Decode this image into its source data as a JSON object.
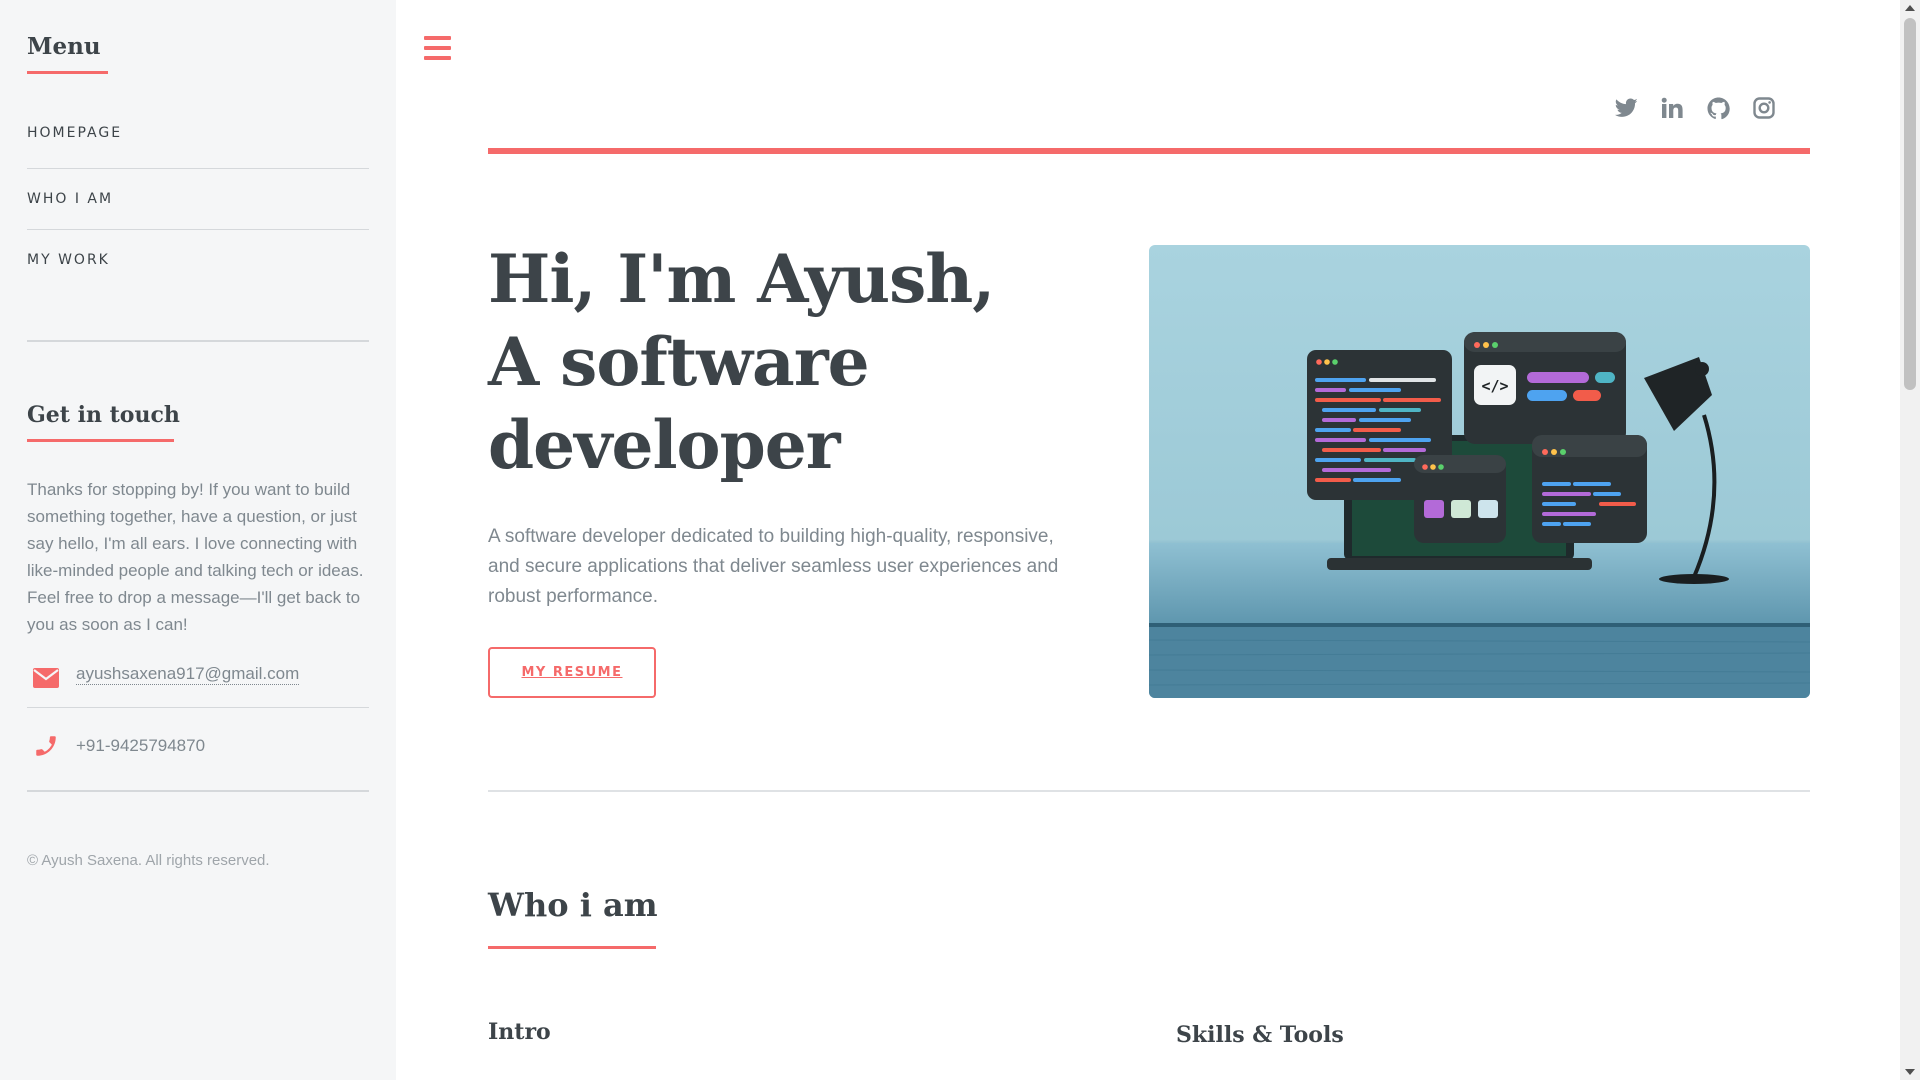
{
  "sidebar": {
    "menu_title": "Menu",
    "menu_items": [
      {
        "label": "HOMEPAGE"
      },
      {
        "label": "WHO I AM"
      },
      {
        "label": "MY WORK"
      }
    ],
    "touch_title": "Get in touch",
    "touch_text": "Thanks for stopping by! If you want to build something together, have a question, or just say hello, I'm all ears. I love connecting with like-minded people and talking tech or ideas. Feel free to drop a message—I'll get back to you as soon as I can!",
    "email": "ayushsaxena917@gmail.com",
    "phone": "+91-9425794870",
    "copyright": "© Ayush Saxena. All rights reserved."
  },
  "header": {
    "socials": [
      {
        "icon": "twitter-icon"
      },
      {
        "icon": "linkedin-icon"
      },
      {
        "icon": "github-icon"
      },
      {
        "icon": "instagram-icon"
      }
    ]
  },
  "hero": {
    "title_line1": "Hi, I'm Ayush,",
    "title_line2": "A software",
    "title_line3": "developer",
    "description": "A software developer dedicated to building high-quality, responsive, and secure applications that deliver seamless user experiences and robust performance.",
    "button_label": "MY RESUME"
  },
  "section": {
    "title": "Who i am",
    "intro_heading": "Intro",
    "skills_heading": "Skills & Tools"
  },
  "colors": {
    "accent": "#f56a6a",
    "text": "#3d4449",
    "muted": "#7f888f",
    "sidebar_bg": "#f5f6f7"
  }
}
